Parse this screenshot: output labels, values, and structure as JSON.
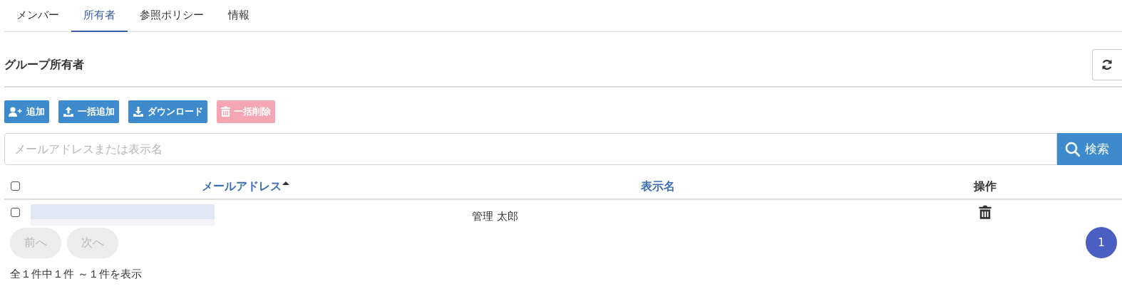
{
  "tabs": [
    {
      "label": "メンバー",
      "selected": false
    },
    {
      "label": "所有者",
      "selected": true
    },
    {
      "label": "参照ポリシー",
      "selected": false
    },
    {
      "label": "情報",
      "selected": false
    }
  ],
  "section": {
    "title": "グループ所有者"
  },
  "actions": [
    {
      "kind": "add",
      "label": "追加",
      "disabled": false
    },
    {
      "kind": "upload",
      "label": "一括追加",
      "disabled": false
    },
    {
      "kind": "download",
      "label": "ダウンロード",
      "disabled": false
    },
    {
      "kind": "delete",
      "label": "一括削除",
      "disabled": true
    }
  ],
  "search": {
    "placeholder": "メールアドレスまたは表示名",
    "button": "検索"
  },
  "table": {
    "select_all_checked": false,
    "columns": [
      {
        "label": "メールアドレス",
        "sort_ascending": true,
        "link": true
      },
      {
        "label": "表示名",
        "sort_ascending": false,
        "link": true
      },
      {
        "label": "操作",
        "sort_ascending": false,
        "link": false
      }
    ],
    "rows": [
      {
        "checked": false,
        "email_redacted": true,
        "name": "管理 太郎"
      }
    ]
  },
  "pagination": {
    "prev": {
      "label": "前へ",
      "disabled": true
    },
    "next": {
      "label": "次へ",
      "disabled": true
    },
    "pages": [
      {
        "label": "1",
        "selected": true
      }
    ]
  },
  "summary": "全１件中１件 ～１件を表示"
}
